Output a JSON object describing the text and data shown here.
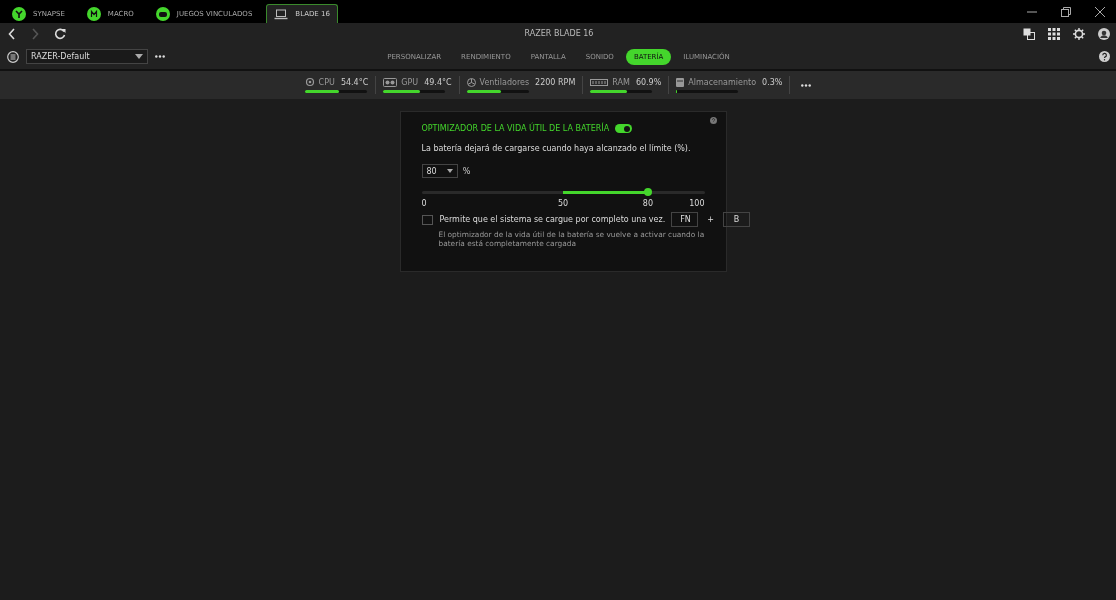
{
  "app_tabs": [
    {
      "label": "SYNAPSE",
      "kind": "synapse",
      "selected": false
    },
    {
      "label": "MACRO",
      "kind": "macro",
      "selected": false
    },
    {
      "label": "JUEGOS VINCULADOS",
      "kind": "gamepad",
      "selected": false
    },
    {
      "label": "BLADE 16",
      "kind": "laptop",
      "selected": true
    }
  ],
  "window": {
    "title": "RAZER BLADE 16"
  },
  "profile": {
    "value": "RAZER-Default"
  },
  "nav_tabs": [
    {
      "label": "PERSONALIZAR",
      "selected": false
    },
    {
      "label": "RENDIMIENTO",
      "selected": false
    },
    {
      "label": "PANTALLA",
      "selected": false
    },
    {
      "label": "SONIDO",
      "selected": false
    },
    {
      "label": "BATERÍA",
      "selected": true
    },
    {
      "label": "ILUMINACIÓN",
      "selected": false
    }
  ],
  "stats": [
    {
      "kind": "cpu",
      "label": "CPU",
      "value": "54.4°C",
      "level": 0.55
    },
    {
      "kind": "gpu",
      "label": "GPU",
      "value": "49.4°C",
      "level": 0.6
    },
    {
      "kind": "fan",
      "label": "Ventiladores",
      "value": "2200 RPM",
      "level": 0.55
    },
    {
      "kind": "ram",
      "label": "RAM",
      "value": "60.9%",
      "level": 0.6
    },
    {
      "kind": "storage",
      "label": "Almacenamiento",
      "value": "0.3%",
      "level": 0.01
    }
  ],
  "battery": {
    "title": "OPTIMIZADOR DE LA VIDA ÚTIL DE LA BATERÍA",
    "on": true,
    "description": "La batería dejará de cargarse cuando haya alcanzado el límite (%).",
    "limit": "80",
    "unit": "%",
    "level": 0.8,
    "ticks": [
      "0",
      "50",
      "80",
      "100"
    ],
    "full_charge": {
      "label": "Permite que el sistema se cargue por completo una vez.",
      "checked": false,
      "keys": [
        "FN",
        "B"
      ],
      "plus": "+",
      "note": "El optimizador de la vida útil de la batería se vuelve a activar cuando la batería está completamente cargada"
    }
  }
}
